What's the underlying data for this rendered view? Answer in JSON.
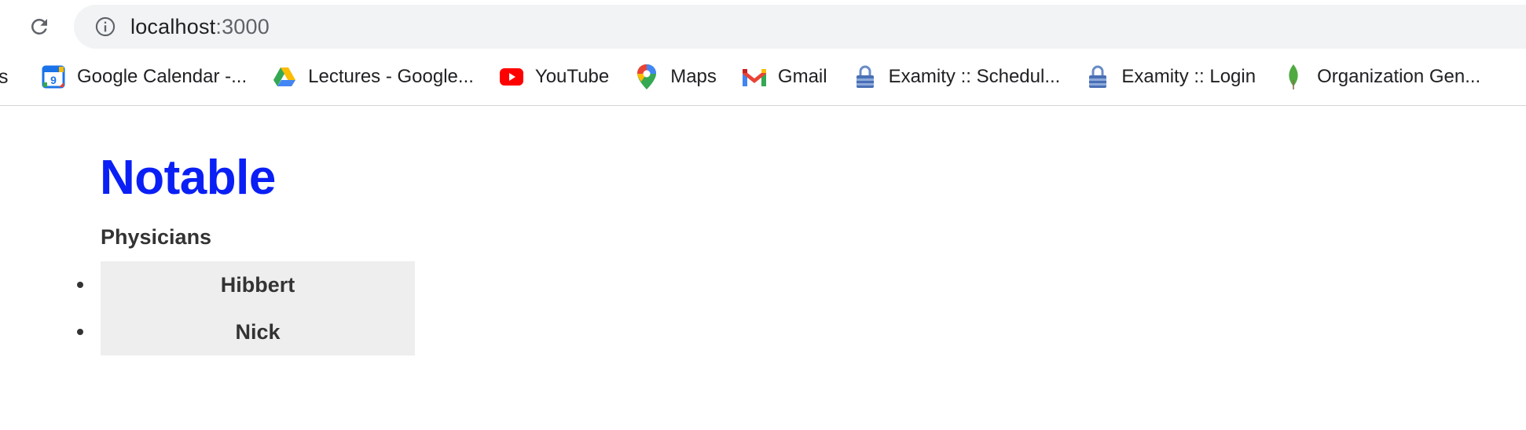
{
  "browser": {
    "url_host": "localhost",
    "url_port": ":3000",
    "bookmarks_clipped_prefix": "s",
    "bookmarks": [
      {
        "label": "Google Calendar -...",
        "icon": "google-calendar-icon"
      },
      {
        "label": "Lectures - Google...",
        "icon": "google-drive-icon"
      },
      {
        "label": "YouTube",
        "icon": "youtube-icon"
      },
      {
        "label": "Maps",
        "icon": "google-maps-icon"
      },
      {
        "label": "Gmail",
        "icon": "gmail-icon"
      },
      {
        "label": "Examity :: Schedul...",
        "icon": "lock-icon"
      },
      {
        "label": "Examity :: Login",
        "icon": "lock-icon"
      },
      {
        "label": "Organization Gen...",
        "icon": "mongodb-leaf-icon"
      }
    ]
  },
  "page": {
    "title": "Notable",
    "section_heading": "Physicians",
    "physicians": [
      "Hibbert",
      "Nick"
    ]
  },
  "colors": {
    "title": "#0a1ff5",
    "list_background": "#eeeeee",
    "text": "#333333"
  }
}
